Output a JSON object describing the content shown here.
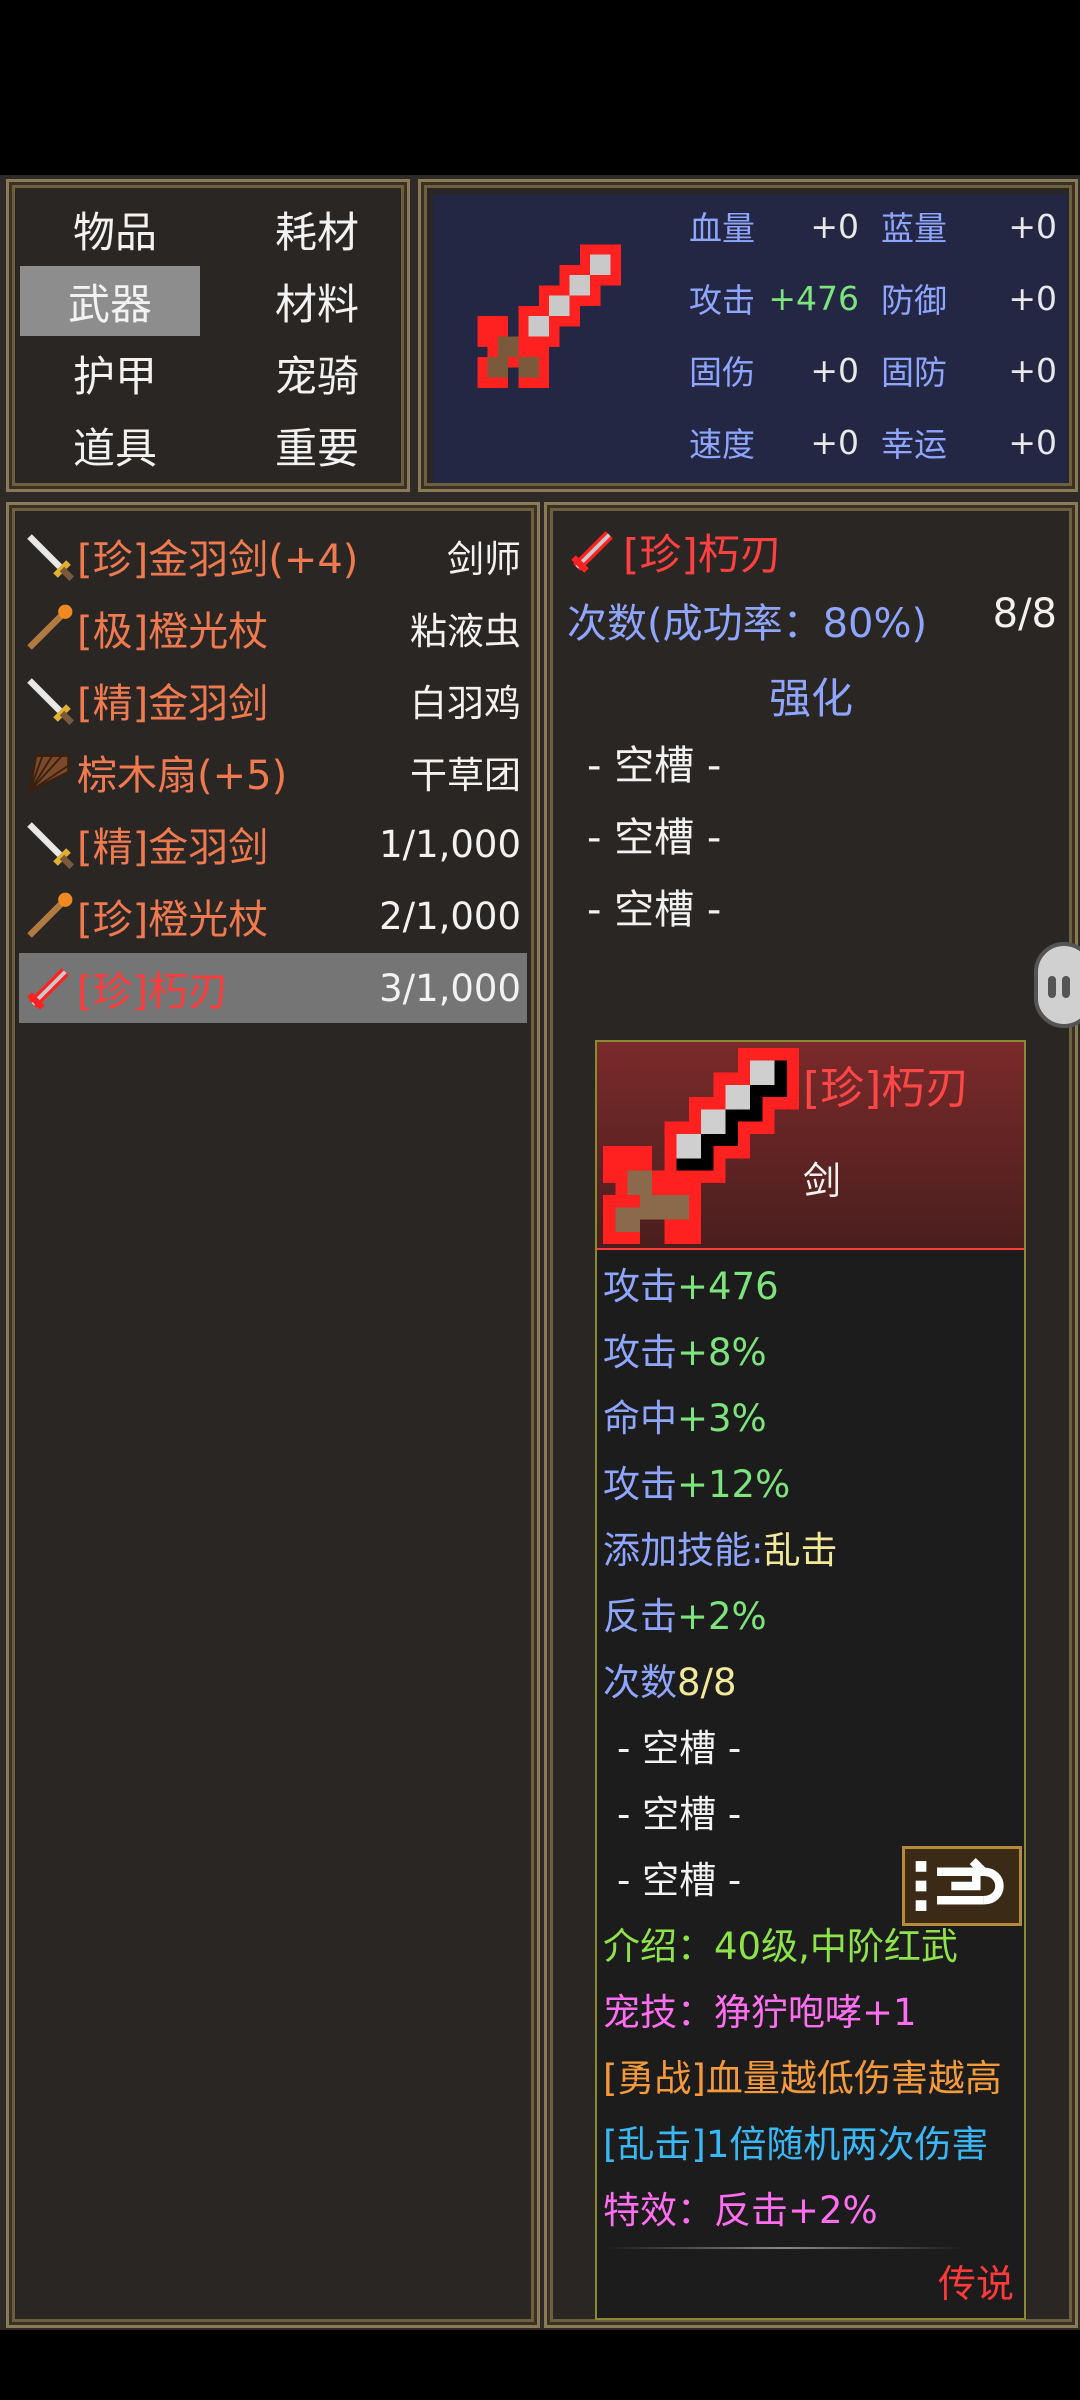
{
  "categories": [
    {
      "label": "物品",
      "selected": false
    },
    {
      "label": "耗材",
      "selected": false
    },
    {
      "label": "武器",
      "selected": true
    },
    {
      "label": "材料",
      "selected": false
    },
    {
      "label": "护甲",
      "selected": false
    },
    {
      "label": "宠骑",
      "selected": false
    },
    {
      "label": "道具",
      "selected": false
    },
    {
      "label": "重要",
      "selected": false
    }
  ],
  "stats": [
    {
      "label": "血量",
      "value": "+0"
    },
    {
      "label": "蓝量",
      "value": "+0"
    },
    {
      "label": "攻击",
      "value": "+476"
    },
    {
      "label": "防御",
      "value": "+0"
    },
    {
      "label": "固伤",
      "value": "+0"
    },
    {
      "label": "固防",
      "value": "+0"
    },
    {
      "label": "速度",
      "value": "+0"
    },
    {
      "label": "幸运",
      "value": "+0"
    }
  ],
  "items": [
    {
      "name": "[珍]金羽剑(+4)",
      "owner": "剑师",
      "icon": "sword-icon"
    },
    {
      "name": "[极]橙光杖",
      "owner": "粘液虫",
      "icon": "staff-icon"
    },
    {
      "name": "[精]金羽剑",
      "owner": "白羽鸡",
      "icon": "sword-icon"
    },
    {
      "name": "棕木扇(+5)",
      "owner": "干草团",
      "icon": "fan-icon"
    },
    {
      "name": "[精]金羽剑",
      "owner": "1/1,000",
      "icon": "sword-icon"
    },
    {
      "name": "[珍]橙光杖",
      "owner": "2/1,000",
      "icon": "staff-icon"
    },
    {
      "name": "[珍]朽刃",
      "owner": "3/1,000",
      "icon": "red-sword-icon"
    }
  ],
  "detail": {
    "title": "[珍]朽刃",
    "count_label": "次数(成功率：80%)",
    "count_value": "8/8",
    "enhance_label": "强化",
    "slots": [
      "- 空槽 -",
      "- 空槽 -",
      "- 空槽 -"
    ]
  },
  "tooltip": {
    "name": "[珍]朽刃",
    "type": "剑",
    "atk_label": "攻击",
    "atk_value": "+476",
    "atkp_label": "攻击",
    "atkp_value": "+8%",
    "hit_label": "命中",
    "hit_value": "+3%",
    "atkp2_label": "攻击",
    "atkp2_value": "+12%",
    "skill_label": "添加技能:",
    "skill_value": "乱击",
    "counter_label": "反击",
    "counter_value": "+2%",
    "count_label": "次数",
    "count_value": "8/8",
    "slots": [
      "- 空槽 -",
      "- 空槽 -",
      "- 空槽 -"
    ],
    "intro": "介绍：40级,中阶红武",
    "pet_skill_label": "宠技：",
    "pet_skill_value": "狰狞咆哮+1",
    "brave": "[勇战]血量越低伤害越高",
    "chaos": "[乱击]1倍随机两次伤害",
    "effect_label": "特效：",
    "effect_value": "反击+2%",
    "rarity": "传说"
  }
}
